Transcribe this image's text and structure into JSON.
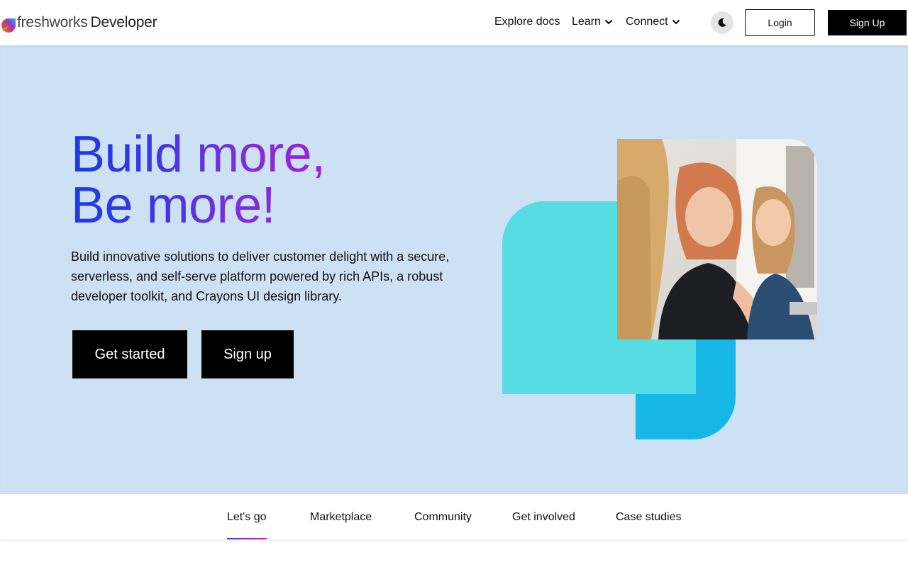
{
  "header": {
    "logo": {
      "brand": "freshworks",
      "product": "Developer"
    },
    "nav": [
      {
        "label": "Explore docs",
        "has_dropdown": false
      },
      {
        "label": "Learn",
        "has_dropdown": true
      },
      {
        "label": "Connect",
        "has_dropdown": true
      }
    ],
    "theme_toggle_icon": "moon-icon",
    "login_label": "Login",
    "signup_label": "Sign Up"
  },
  "hero": {
    "headline_line1": "Build more,",
    "headline_line2": "Be more!",
    "description": "Build innovative solutions to deliver customer delight with a secure, serverless, and self-serve platform powered by rich APIs, a robust developer toolkit, and Crayons UI design library.",
    "primary_button": "Get started",
    "secondary_button": "Sign up"
  },
  "tabs": {
    "items": [
      "Let's go",
      "Marketplace",
      "Community",
      "Get involved",
      "Case studies"
    ],
    "active_index": 0
  },
  "colors": {
    "hero_bg": "#cde1f4",
    "headline_gradient_start": "#1c3ae6",
    "headline_gradient_end": "#a31fd4",
    "shape_cyan": "#56dde3",
    "shape_blue": "#16b7e6",
    "button_bg": "#000000"
  }
}
